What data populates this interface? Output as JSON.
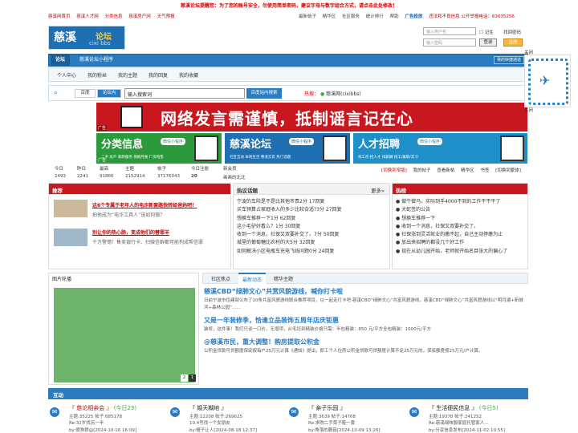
{
  "top": {
    "notice": "慈溪论坛提醒您：为了您的账号安全，勿使用简单密码，建议字母与数字组合方式，请点击此处修改！",
    "left_links": [
      "慈溪网首页",
      "慈溪人才网",
      "分类信息",
      "慈溪房产网",
      "天气预报"
    ],
    "right_links": [
      "最新帖子",
      "精华区",
      "社区服务",
      "统计排行",
      "帮助"
    ],
    "ad_service": "广告投放",
    "report": "违法和不良信息 公开举报电话：63035256"
  },
  "logo": {
    "cn": "慈溪",
    "cn2": "论坛",
    "en": "cixi bbs"
  },
  "login": {
    "username_placeholder": "输入用户名",
    "password_placeholder": "输入密码",
    "remember": "记住",
    "forgot": "找回密码",
    "login_btn": "登录",
    "register_btn": "注册"
  },
  "nav": {
    "items": [
      "论坛",
      "慈溪论坛小程序"
    ],
    "quick": "我的快捷通道"
  },
  "subnav": [
    "个人中心",
    "我的粉丝",
    "我的主题",
    "我的回复",
    "我的收藏"
  ],
  "search": {
    "tabs": [
      "百度",
      "论坛内"
    ],
    "query": "输入搜索词",
    "button": "百度站内搜索",
    "hot_label": "热搜：",
    "hot_term": "慈溪网(cixibbs)"
  },
  "banner": {
    "text": "网络发言需谨慎，抵制谣言记在心",
    "label": "广告"
  },
  "ads": [
    {
      "title": "分类信息",
      "tag": "微信小程序",
      "sub": "二手 房产 家政服务 保姆月嫂 厂房租售",
      "color": "#2a9a3b"
    },
    {
      "title": "慈溪论坛",
      "tag": "微信小程序",
      "sub": "社区互动 本地生活 慈溪交友 热门话题",
      "color": "#1f6fb3"
    },
    {
      "title": "人才招聘",
      "tag": "微信小程序",
      "sub": "找工作·招人才 排薪酬 找工/兼职/实习",
      "color": "#1f8fc9"
    }
  ],
  "ad_label": "广告",
  "stats": [
    {
      "k": "今日",
      "v": "2493",
      "red": false
    },
    {
      "k": "昨日",
      "v": "2241",
      "red": false
    },
    {
      "k": "最高",
      "v": "91866",
      "red": false
    },
    {
      "k": "主题",
      "v": "2152914",
      "red": false
    },
    {
      "k": "帖子",
      "v": "37176043",
      "red": false
    },
    {
      "k": "今日注册",
      "v": "20",
      "red": false
    },
    {
      "k": "新会员",
      "v": "画画的北北",
      "red": false
    }
  ],
  "statlinks": [
    "[切换到窄版]",
    "我的帖子",
    "查看新帖",
    "精华区",
    "书签",
    "[切换到繁体]"
  ],
  "recommend": {
    "title": "推荐",
    "items": [
      {
        "title": "这6个专属于老年人的电诈新套路快转给爸妈吧！",
        "desc": "拍他成为“电诈工具人”该如何做？"
      },
      {
        "title": "别让你的热心肠，变成他们的替罪羊",
        "desc": "千万警惕！售卖银行卡、扫微信群都可能构成帮信罪"
      }
    ]
  },
  "hot_topics": {
    "title": "热议话题",
    "more": "更多»",
    "items": [
      "宁波的车险是不是比其他市贵2分 17回复",
      "买车预算占家庭收入的多少比较合适?3分 27回复",
      "想换车推荐一下1分 62回复",
      "这小毛驴好看么？1分 30回复",
      "收到一个消息，社保又双要补交了。7分 50回复",
      "城里的葡萄糖比农村的大5分 32回复",
      "如何解决小区电瓶车充电飞线问题0分 24回复"
    ]
  },
  "hot_list": {
    "title": "热榜",
    "items": [
      "做牛做马，实际到手4000不到的工作干不干了",
      "大蛇签约公告",
      "想换车推荐一下",
      "收到一个消息，社保又双要补交了。",
      "社保涨到灵活就业的缴不起，自己主动停缴为止",
      "放出来招聘的都没几个好工作",
      "现在从幼儿园开始，老师就开始名目张大的偏心了"
    ]
  },
  "slider": {
    "title": "图片轮播",
    "pages": [
      "2",
      "1"
    ]
  },
  "tabs2": [
    "社区焦点",
    "最新动态",
    "精华主题"
  ],
  "news": [
    {
      "title": "慈溪CBD“绿肺文心”共赏风貌游线，喊你打卡啦",
      "desc": "日前宁波市住建部公布了10条共富风貌游线联合推荐项目，以一起走打卡吧-慈溪CBD“绿肺文心”共富风貌游线，慈溪CBD“绿肺文心”共富风貌游线以“明月湖+新城河+森林公园”……"
    },
    {
      "title": "又是一年装修季，恰逢立品装饰五周年店庆钜惠",
      "desc": "装修，这件事！我们只谈一口价，无增项，从毛坯到精装价格只需：半包精装：850 元/平方全包精装：1600元/平方"
    },
    {
      "title": "@慈溪市民，重大调整！购房提取公积金",
      "desc": "公积金贷款可贷额度保底按每户25万元计算《通知》提出，即工个人住房公积金贷款可贷额度计算不足25万元的，保底额度按25万元/户计算。"
    }
  ],
  "interact": {
    "title": "互动",
    "forums": [
      {
        "name": "『 慈论相亲会 』",
        "today": "(今日23)",
        "meta": "主题:35225  帖子:685178",
        "last": "Re:32岁找另一半",
        "by": "by:傻狗狼@[2024-10-16 16:09]"
      },
      {
        "name": "『 婚天糊地 』",
        "today": "",
        "meta": "主题:12208  帖子:269625",
        "last": "10.4号找一个女朋友",
        "by": "by:幔子让人[2024-08-18 12:37]"
      },
      {
        "name": "『 亲子乐园 』",
        "today": "",
        "meta": "主题:3639  帖子:14768",
        "last": "Re:求购二手菜子鞋一套",
        "by": "by:角落的蘑菇[2024-10-09 13:26]"
      },
      {
        "name": "『 生活便民信息 』",
        "today": "(今日5)",
        "meta": "主题:19378  帖子:241252",
        "last": "Re:慈溪绿枝服家庭托管家人…",
        "by": "by:分享信息发布[2024-11-02 10:55]"
      }
    ]
  },
  "side": {
    "close": "关闭"
  }
}
